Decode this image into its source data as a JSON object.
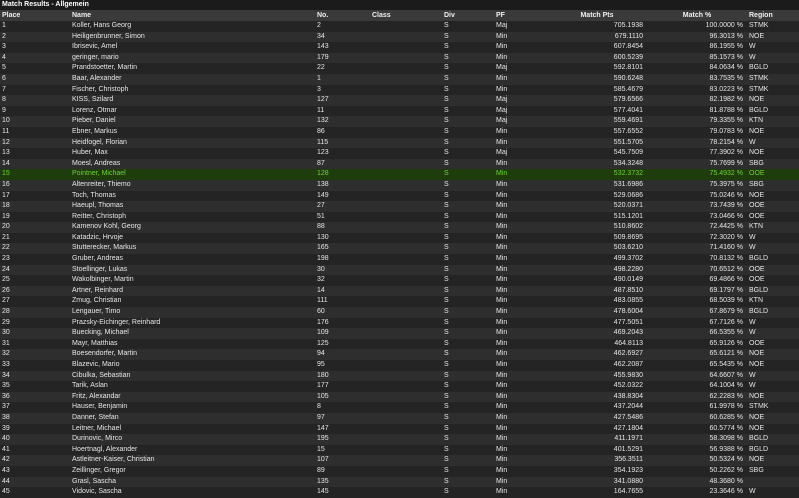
{
  "title": "Match Results - Allgemein",
  "columns": [
    "Place",
    "Name",
    "No.",
    "Class",
    "Div",
    "PF",
    "Match Pts",
    "Match %",
    "Region"
  ],
  "highlight_place": "15",
  "rows": [
    [
      "1",
      "Koller, Hans Georg",
      "2",
      "",
      "S",
      "Maj",
      "705.1938",
      "100.0000 %",
      "STMK"
    ],
    [
      "2",
      "Heiligenbrunner, Simon",
      "34",
      "",
      "S",
      "Min",
      "679.1110",
      "96.3013 %",
      "NOE"
    ],
    [
      "3",
      "Ibrisevic, Amel",
      "143",
      "",
      "S",
      "Min",
      "607.8454",
      "86.1955 %",
      "W"
    ],
    [
      "4",
      "geringer, mario",
      "179",
      "",
      "S",
      "Min",
      "600.5239",
      "85.1573 %",
      "W"
    ],
    [
      "5",
      "Prandstoetter, Martin",
      "22",
      "",
      "S",
      "Maj",
      "592.8101",
      "84.0634 %",
      "BGLD"
    ],
    [
      "6",
      "Baar, Alexander",
      "1",
      "",
      "S",
      "Min",
      "590.6248",
      "83.7535 %",
      "STMK"
    ],
    [
      "7",
      "Fischer, Christoph",
      "3",
      "",
      "S",
      "Min",
      "585.4679",
      "83.0223 %",
      "STMK"
    ],
    [
      "8",
      "KISS, Szilard",
      "127",
      "",
      "S",
      "Maj",
      "579.6566",
      "82.1982 %",
      "NOE"
    ],
    [
      "9",
      "Lorenz, Otmar",
      "11",
      "",
      "S",
      "Maj",
      "577.4041",
      "81.8788 %",
      "BGLD"
    ],
    [
      "10",
      "Pieber, Daniel",
      "132",
      "",
      "S",
      "Maj",
      "559.4691",
      "79.3355 %",
      "KTN"
    ],
    [
      "11",
      "Ebner, Markus",
      "86",
      "",
      "S",
      "Min",
      "557.6552",
      "79.0783 %",
      "NOE"
    ],
    [
      "12",
      "Heidfogel, Florian",
      "115",
      "",
      "S",
      "Min",
      "551.5705",
      "78.2154 %",
      "W"
    ],
    [
      "13",
      "Huber, Max",
      "123",
      "",
      "S",
      "Maj",
      "545.7509",
      "77.3902 %",
      "NOE"
    ],
    [
      "14",
      "Moesl, Andreas",
      "87",
      "",
      "S",
      "Min",
      "534.3248",
      "75.7699 %",
      "SBG"
    ],
    [
      "15",
      "Pointner, Michael",
      "128",
      "",
      "S",
      "Min",
      "532.3732",
      "75.4932 %",
      "OOE"
    ],
    [
      "16",
      "Altenreiter, Thiemo",
      "138",
      "",
      "S",
      "Min",
      "531.6986",
      "75.3975 %",
      "SBG"
    ],
    [
      "17",
      "Toch, Thomas",
      "149",
      "",
      "S",
      "Min",
      "529.0686",
      "75.0246 %",
      "NOE"
    ],
    [
      "18",
      "Haeupl, Thomas",
      "27",
      "",
      "S",
      "Min",
      "520.0371",
      "73.7439 %",
      "OOE"
    ],
    [
      "19",
      "Reitter, Christoph",
      "51",
      "",
      "S",
      "Min",
      "515.1201",
      "73.0466 %",
      "OOE"
    ],
    [
      "20",
      "Kamenov Kohl, Georg",
      "88",
      "",
      "S",
      "Min",
      "510.8602",
      "72.4425 %",
      "KTN"
    ],
    [
      "21",
      "Katadzic, Hrvoje",
      "130",
      "",
      "S",
      "Min",
      "509.8695",
      "72.3020 %",
      "W"
    ],
    [
      "22",
      "Stutterecker, Markus",
      "165",
      "",
      "S",
      "Min",
      "503.6210",
      "71.4160 %",
      "W"
    ],
    [
      "23",
      "Gruber, Andreas",
      "198",
      "",
      "S",
      "Min",
      "499.3702",
      "70.8132 %",
      "BGLD"
    ],
    [
      "24",
      "Stoellinger, Lukas",
      "30",
      "",
      "S",
      "Min",
      "498.2280",
      "70.6512 %",
      "OOE"
    ],
    [
      "25",
      "Wakolbinger, Martin",
      "32",
      "",
      "S",
      "Min",
      "490.0149",
      "69.4866 %",
      "OOE"
    ],
    [
      "26",
      "Artner, Reinhard",
      "14",
      "",
      "S",
      "Min",
      "487.8510",
      "69.1797 %",
      "BGLD"
    ],
    [
      "27",
      "Zmug, Christian",
      "111",
      "",
      "S",
      "Min",
      "483.0855",
      "68.5039 %",
      "KTN"
    ],
    [
      "28",
      "Lengauer, Timo",
      "60",
      "",
      "S",
      "Min",
      "478.6004",
      "67.8679 %",
      "BGLD"
    ],
    [
      "29",
      "Prazsky-Eichinger, Reinhard",
      "176",
      "",
      "S",
      "Min",
      "477.5051",
      "67.7126 %",
      "W"
    ],
    [
      "30",
      "Buecking, Michael",
      "109",
      "",
      "S",
      "Min",
      "469.2043",
      "66.5355 %",
      "W"
    ],
    [
      "31",
      "Mayr, Matthias",
      "125",
      "",
      "S",
      "Min",
      "464.8113",
      "65.9126 %",
      "OOE"
    ],
    [
      "32",
      "Boesendorfer, Martin",
      "94",
      "",
      "S",
      "Min",
      "462.6927",
      "65.6121 %",
      "NOE"
    ],
    [
      "33",
      "Blazevic, Mario",
      "95",
      "",
      "S",
      "Min",
      "462.2087",
      "65.5435 %",
      "NOE"
    ],
    [
      "34",
      "Cibulka, Sebastian",
      "180",
      "",
      "S",
      "Min",
      "455.9830",
      "64.6607 %",
      "W"
    ],
    [
      "35",
      "Tarik, Aslan",
      "177",
      "",
      "S",
      "Min",
      "452.0322",
      "64.1004 %",
      "W"
    ],
    [
      "36",
      "Fritz, Alexandar",
      "105",
      "",
      "S",
      "Min",
      "438.8304",
      "62.2283 %",
      "NOE"
    ],
    [
      "37",
      "Hauser, Benjamin",
      "8",
      "",
      "S",
      "Min",
      "437.2044",
      "61.9978 %",
      "STMK"
    ],
    [
      "38",
      "Danner, Stefan",
      "97",
      "",
      "S",
      "Min",
      "427.5486",
      "60.6285 %",
      "NOE"
    ],
    [
      "39",
      "Leitner, Michael",
      "147",
      "",
      "S",
      "Min",
      "427.1804",
      "60.5774 %",
      "NOE"
    ],
    [
      "40",
      "Durinovic, Mirco",
      "195",
      "",
      "S",
      "Min",
      "411.1971",
      "58.3098 %",
      "BGLD"
    ],
    [
      "41",
      "Hoertnagl, Alexander",
      "15",
      "",
      "S",
      "Min",
      "401.5291",
      "56.9388 %",
      "BGLD"
    ],
    [
      "42",
      "Astleitner-Kaiser, Christian",
      "107",
      "",
      "S",
      "Min",
      "356.3511",
      "50.5324 %",
      "NOE"
    ],
    [
      "43",
      "Zeillinger, Gregor",
      "89",
      "",
      "S",
      "Min",
      "354.1923",
      "50.2262 %",
      "SBG"
    ],
    [
      "44",
      "Grasl, Sascha",
      "135",
      "",
      "S",
      "Min",
      "341.0880",
      "48.3680 %",
      ""
    ],
    [
      "45",
      "Vidovic, Sascha",
      "145",
      "",
      "S",
      "Min",
      "164.7655",
      "23.3646 %",
      "W"
    ]
  ],
  "colors": {
    "background": "#1b1b1b",
    "header": "#3a3a3a",
    "row_odd": "#242424",
    "row_even": "#2e2e2e",
    "highlight_bg": "#1f3d0c",
    "highlight_text": "#6cd23a"
  }
}
